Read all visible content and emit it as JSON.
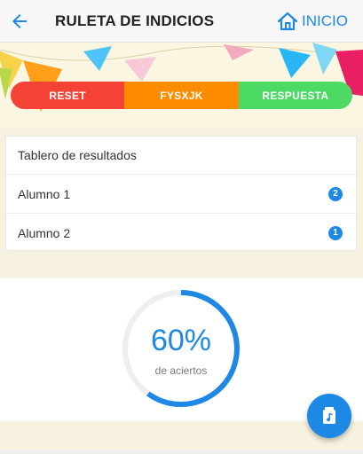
{
  "header": {
    "title": "RULETA DE INDICIOS",
    "home_label": "INICIO",
    "icons": {
      "back": "arrow-left-icon",
      "home": "home-icon"
    }
  },
  "actions": {
    "reset_label": "RESET",
    "word_label": "FYSXJK",
    "answer_label": "RESPUESTA"
  },
  "scoreboard": {
    "title": "Tablero de resultados",
    "rows": [
      {
        "name": "Alumno 1",
        "count": "2"
      },
      {
        "name": "Alumno 2",
        "count": "1"
      }
    ]
  },
  "score": {
    "percent_label": "60%",
    "percent_value": 0.6,
    "caption": "de aciertos"
  },
  "fab": {
    "icon": "music-note-icon"
  },
  "colors": {
    "accent": "#1e88e5",
    "reset": "#f44336",
    "word": "#ff8c00",
    "answer": "#4cd964",
    "ring_track": "#eeeeee"
  }
}
